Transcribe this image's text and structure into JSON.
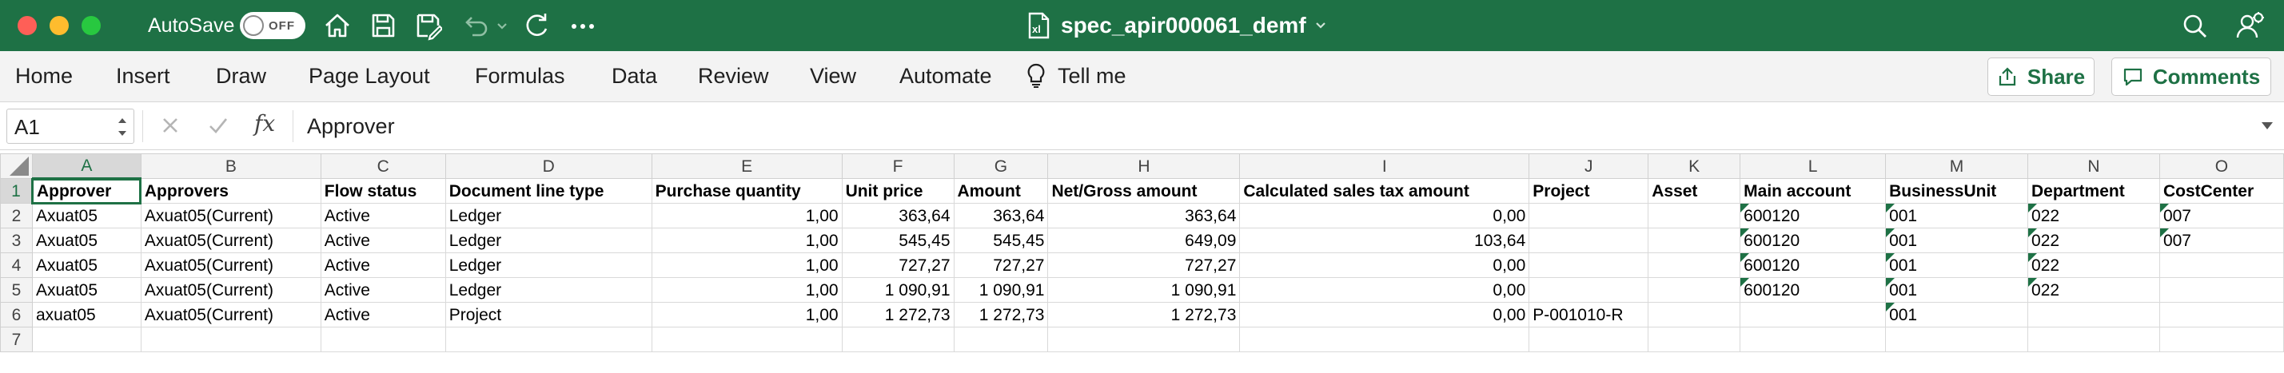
{
  "window": {
    "autosave_label": "AutoSave",
    "autosave_state": "OFF",
    "title": "spec_apir000061_demf"
  },
  "ribbon": {
    "tabs": [
      "Home",
      "Insert",
      "Draw",
      "Page Layout",
      "Formulas",
      "Data",
      "Review",
      "View",
      "Automate"
    ],
    "tell_me": "Tell me",
    "share_label": "Share",
    "comments_label": "Comments"
  },
  "formula_bar": {
    "cell_ref": "A1",
    "content": "Approver"
  },
  "sheet": {
    "columns": [
      "A",
      "B",
      "C",
      "D",
      "E",
      "F",
      "G",
      "H",
      "I",
      "J",
      "K",
      "L",
      "M",
      "N",
      "O"
    ],
    "row_numbers": [
      "1",
      "2",
      "3",
      "4",
      "5",
      "6",
      "7"
    ],
    "rows": [
      [
        "Approver",
        "Approvers",
        "Flow status",
        "Document line type",
        "Purchase quantity",
        "Unit price",
        "Amount",
        "Net/Gross amount",
        "Calculated sales tax amount",
        "Project",
        "Asset",
        "Main account",
        "BusinessUnit",
        "Department",
        "CostCenter"
      ],
      [
        "Axuat05",
        "Axuat05(Current)",
        "Active",
        "Ledger",
        "1,00",
        "363,64",
        "363,64",
        "363,64",
        "0,00",
        "",
        "",
        "600120",
        "001",
        "022",
        "007"
      ],
      [
        "Axuat05",
        "Axuat05(Current)",
        "Active",
        "Ledger",
        "1,00",
        "545,45",
        "545,45",
        "649,09",
        "103,64",
        "",
        "",
        "600120",
        "001",
        "022",
        "007"
      ],
      [
        "Axuat05",
        "Axuat05(Current)",
        "Active",
        "Ledger",
        "1,00",
        "727,27",
        "727,27",
        "727,27",
        "0,00",
        "",
        "",
        "600120",
        "001",
        "022",
        ""
      ],
      [
        "Axuat05",
        "Axuat05(Current)",
        "Active",
        "Ledger",
        "1,00",
        "1 090,91",
        "1 090,91",
        "1 090,91",
        "0,00",
        "",
        "",
        "600120",
        "001",
        "022",
        ""
      ],
      [
        "axuat05",
        "Axuat05(Current)",
        "Active",
        "Project",
        "1,00",
        "1 272,73",
        "1 272,73",
        "1 272,73",
        "0,00",
        "P-001010-R",
        "",
        "",
        "001",
        "",
        ""
      ],
      [
        "",
        "",
        "",
        "",
        "",
        "",
        "",
        "",
        "",
        "",
        "",
        "",
        "",
        "",
        ""
      ]
    ]
  },
  "colors": {
    "accent": "#1e7145",
    "ribbon_bg": "#f3f3f3",
    "gridline": "#d9d9d9"
  },
  "icons": [
    "home-icon",
    "save-icon",
    "save-as-icon",
    "undo-icon",
    "redo-icon",
    "more-icon",
    "excel-file-icon",
    "search-icon",
    "account-icon",
    "lightbulb-icon",
    "share-icon",
    "comment-icon",
    "cancel-icon",
    "enter-icon",
    "fx-icon"
  ]
}
